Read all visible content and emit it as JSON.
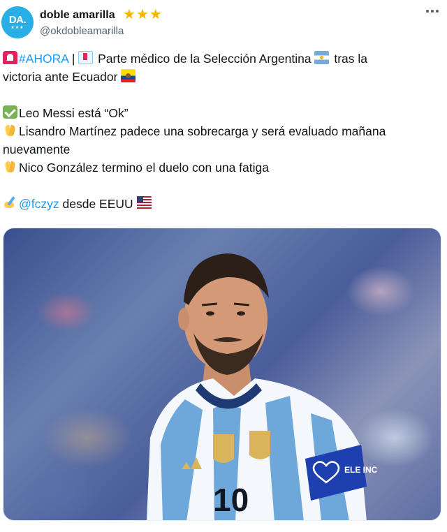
{
  "user": {
    "avatar_text": "DA.",
    "avatar_stars": "★★★",
    "display_name": "doble amarilla",
    "handle": "@okdobleamarilla",
    "badge_stars": [
      "★",
      "★",
      "★"
    ]
  },
  "tweet": {
    "line1": {
      "hashtag": "#AHORA",
      "sep": " | ",
      "text_a": " Parte médico de la Selección Argentina ",
      "text_b": " tras la"
    },
    "line2": {
      "text": "victoria ante Ecuador "
    },
    "line3": "Leo Messi está “Ok”",
    "line4": "Lisandro Martínez padece una sobrecarga y será evaluado mañana",
    "line5": "nuevamente",
    "line6": "Nico González termino el duelo con una fatiga",
    "line7": {
      "mention": "@fczyz",
      "text": " desde EEUU "
    }
  },
  "photo": {
    "jersey_number": "10",
    "armband_text": "ELE INC"
  },
  "icons": {
    "more": "more-options-icon",
    "siren": "rotating-light-icon",
    "hospital": "hospital-icon",
    "flag_ar": "argentina-flag-icon",
    "flag_ec": "ecuador-flag-icon",
    "check": "check-mark-icon",
    "pray": "folded-hands-icon",
    "write": "writing-hand-icon",
    "flag_us": "usa-flag-icon"
  },
  "colors": {
    "link": "#1d9bf0",
    "star": "#f4b400",
    "avatar": "#29aee6"
  }
}
